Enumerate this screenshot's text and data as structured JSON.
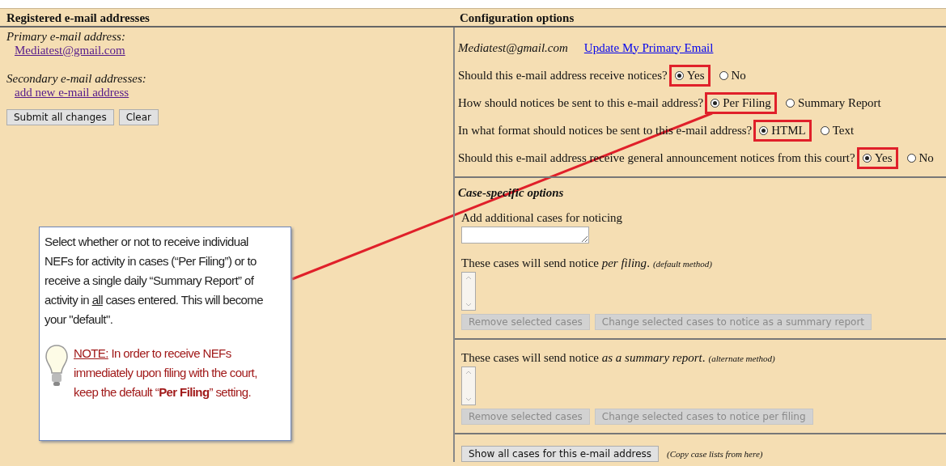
{
  "left": {
    "heading": "Registered e-mail addresses",
    "primary_label": "Primary e-mail address:",
    "primary_email": "Mediatest@gmail.com",
    "secondary_label": "Secondary e-mail addresses:",
    "add_link": "add new e-mail address",
    "buttons": [
      "Submit all changes",
      "Clear"
    ]
  },
  "right": {
    "heading": "Configuration options",
    "email": "Mediatest@gmail.com",
    "update_link": "Update My Primary Email",
    "questions": [
      {
        "text": "Should this e-mail address receive notices?",
        "options": [
          {
            "label": "Yes",
            "selected": true
          },
          {
            "label": "No",
            "selected": false
          }
        ]
      },
      {
        "text": "How should notices be sent to this e-mail address?",
        "options": [
          {
            "label": "Per Filing",
            "selected": true
          },
          {
            "label": "Summary Report",
            "selected": false
          }
        ]
      },
      {
        "text": "In what format should notices be sent to this e-mail address?",
        "options": [
          {
            "label": "HTML",
            "selected": true
          },
          {
            "label": "Text",
            "selected": false
          }
        ]
      },
      {
        "text": "Should this e-mail address receive general announcement notices from this court?",
        "options": [
          {
            "label": "Yes",
            "selected": true
          },
          {
            "label": "No",
            "selected": false
          }
        ]
      }
    ],
    "case_options": {
      "heading": "Case-specific options",
      "add_label": "Add additional cases for noticing",
      "lists": [
        {
          "label": "These cases will send notice *per filing*.",
          "note": "(default method)",
          "buttons": [
            {
              "label": "Remove selected cases",
              "disabled": true
            },
            {
              "label": "Change selected cases to notice as a summary report",
              "disabled": true
            }
          ]
        },
        {
          "label": "These cases will send notice *as a summary report*.",
          "note": "(alternate method)",
          "buttons": [
            {
              "label": "Remove selected cases",
              "disabled": true
            },
            {
              "label": "Change selected cases to notice per filing",
              "disabled": true
            }
          ]
        }
      ],
      "show_button": "Show all cases for this e-mail address",
      "show_note": "(Copy case lists from here)"
    }
  },
  "callout": {
    "paragraphs": [
      {
        "kind": "text",
        "segments": [
          {
            "text": "Select whether or not to receive individual NEFs for activity in cases (“Per Filing”) or to receive a single daily “Summary Report” of activity in ",
            "underline": false,
            "bold": false
          },
          {
            "text": "all",
            "underline": true,
            "bold": false
          },
          {
            "text": " cases entered. This will become your \"default\".",
            "underline": false,
            "bold": false
          }
        ]
      },
      {
        "kind": "note",
        "segments": [
          {
            "text": "NOTE:",
            "underline": true,
            "bold": false
          },
          {
            "text": " In order to receive NEFs immediately upon filing with the court, keep the default “",
            "underline": false,
            "bold": false
          },
          {
            "text": "Per Filing",
            "underline": false,
            "bold": true
          },
          {
            "text": "” setting.",
            "underline": false,
            "bold": false
          }
        ]
      }
    ]
  }
}
